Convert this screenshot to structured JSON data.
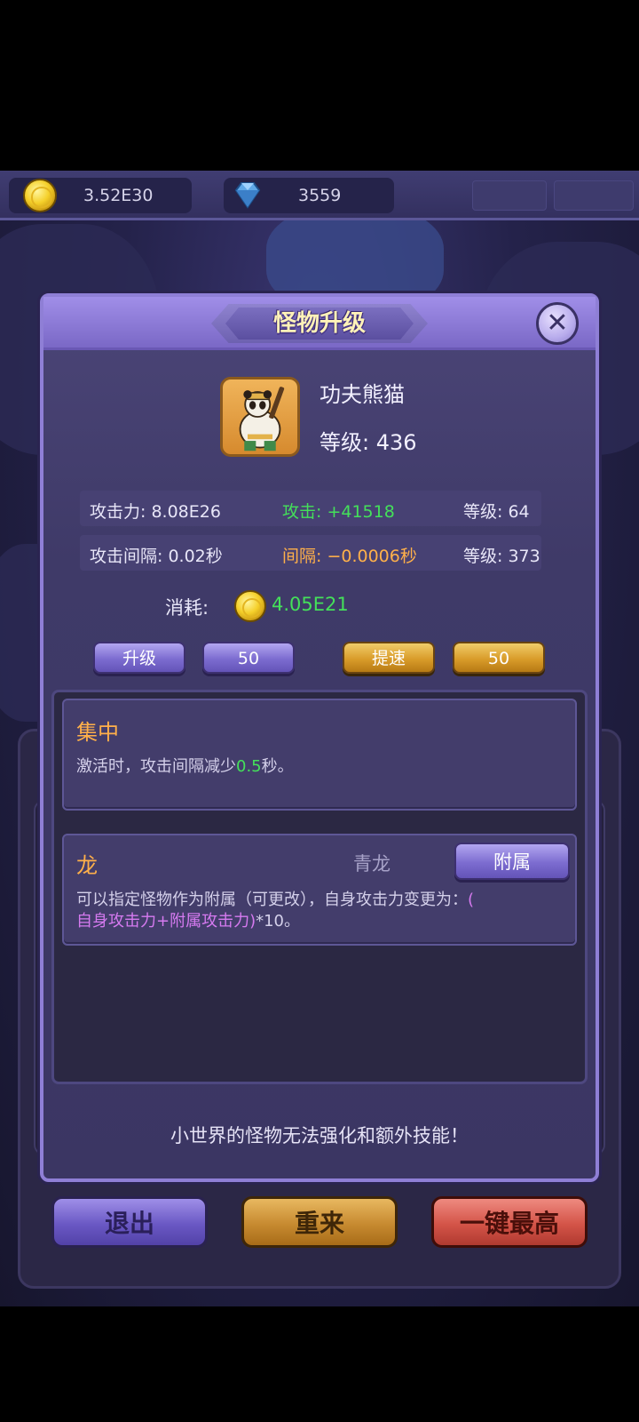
{
  "resources": {
    "gold": "3.52E30",
    "diamonds": "3559"
  },
  "dialog": {
    "title": "怪物升级",
    "close_icon": "close-icon"
  },
  "monster": {
    "name": "功夫熊猫",
    "level_text": "等级: 436"
  },
  "stats": {
    "attack": {
      "label": "攻击力: 8.08E26",
      "bonus": "攻击: +41518",
      "level": "等级: 64",
      "bonus_color": "#44e05a"
    },
    "interval": {
      "label": "攻击间隔: 0.02秒",
      "bonus": "间隔: −0.0006秒",
      "level": "等级: 373",
      "bonus_color": "#ffb04a"
    }
  },
  "cost": {
    "label": "消耗:",
    "value": "4.05E21"
  },
  "buttons": {
    "upgrade": "升级",
    "upgrade_count": "50",
    "speedup": "提速",
    "speedup_count": "50"
  },
  "skills": [
    {
      "title": "集中",
      "desc_pre": "激活时，攻击间隔减少",
      "desc_value": "0.5",
      "desc_post": "秒。"
    },
    {
      "title": "龙",
      "type": "青龙",
      "button": "附属",
      "desc_line1_pre": "可以指定怪物作为附属（可更改），自身攻击力变更为：",
      "desc_line1_hl": "(",
      "desc_line2_hl": "自身攻击力+附属攻击力)",
      "desc_line2_post": "*10。"
    }
  ],
  "footer_note": "小世界的怪物无法强化和额外技能！",
  "bottom_buttons": {
    "exit": "退出",
    "restart": "重来",
    "max": "一键最高"
  }
}
